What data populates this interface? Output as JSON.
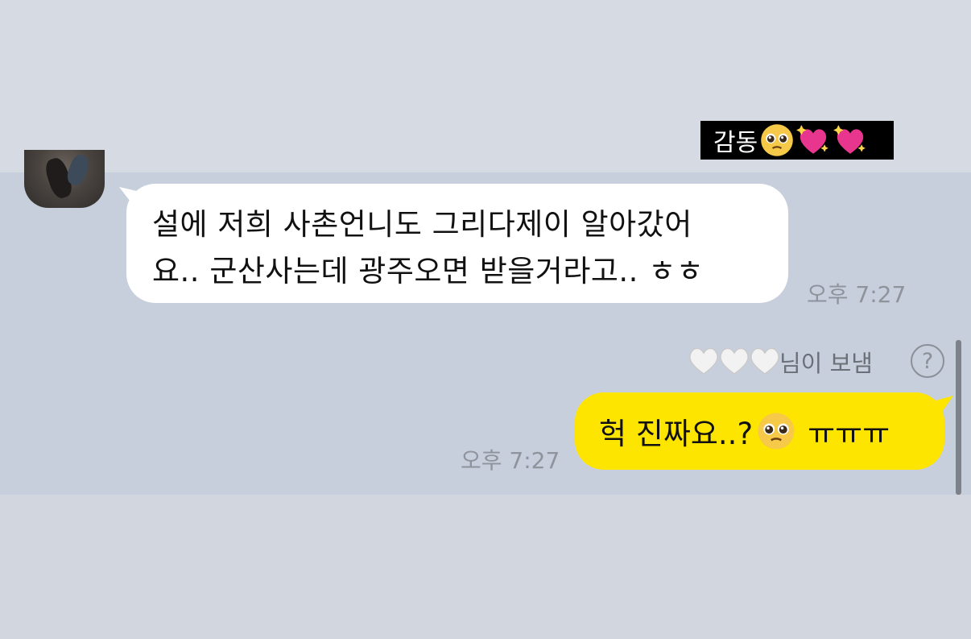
{
  "caption": {
    "text": "감동",
    "emoji_icons": [
      "pleading-face-icon",
      "sparkling-heart-icon",
      "sparkling-heart-icon"
    ]
  },
  "messages": {
    "incoming": {
      "avatar": "profile-photo",
      "lines": [
        "설에 저희 사촌언니도 그리다제이 알아갔어",
        "요.. 군산사는데 광주오면 받을거라고.. ㅎㅎ"
      ],
      "time": "오후 7:27"
    },
    "sender_note": {
      "hearts": [
        "white-heart-icon",
        "white-heart-icon",
        "white-heart-icon"
      ],
      "text": "님이 보냄",
      "help_label": "?"
    },
    "outgoing": {
      "text_before_emoji": "헉 진짜요..?",
      "emoji": "pleading-face-icon",
      "text_after_emoji": "ㅠㅠㅠ",
      "time": "오후 7:27"
    }
  },
  "colors": {
    "incoming_bubble": "#ffffff",
    "outgoing_bubble": "#fee500",
    "chat_background": "#c8cfdc",
    "caption_background": "#000000"
  }
}
